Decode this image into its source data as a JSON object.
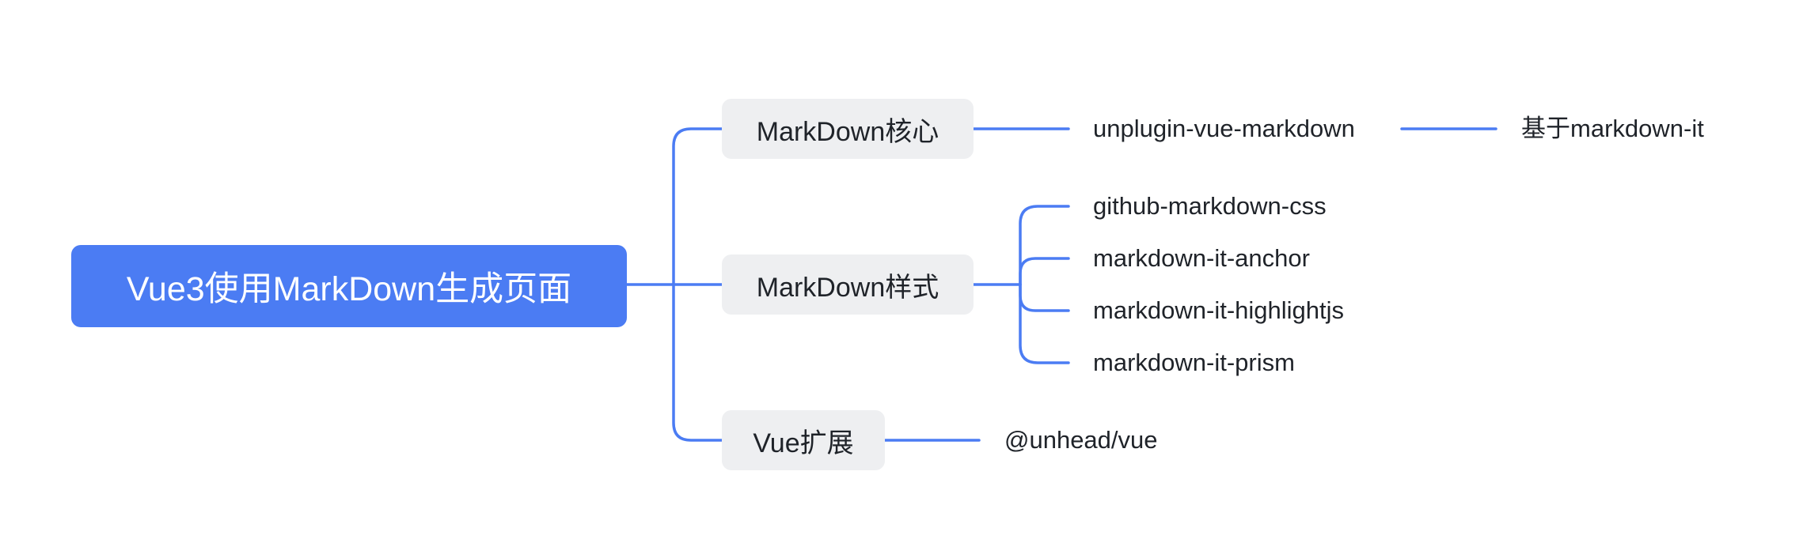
{
  "colors": {
    "root_fill": "#4b7cf3",
    "line": "#4b7cf3",
    "branch_fill": "#eeeff1",
    "text": "#1f2329"
  },
  "root": {
    "label": "Vue3使用MarkDown生成页面"
  },
  "branches": [
    {
      "label": "MarkDown核心",
      "children": [
        {
          "label": "unplugin-vue-markdown",
          "children": [
            {
              "label": "基于markdown-it"
            }
          ]
        }
      ]
    },
    {
      "label": "MarkDown样式",
      "children": [
        {
          "label": "github-markdown-css"
        },
        {
          "label": "markdown-it-anchor"
        },
        {
          "label": "markdown-it-highlightjs"
        },
        {
          "label": "markdown-it-prism"
        }
      ]
    },
    {
      "label": "Vue扩展",
      "children": [
        {
          "label": "@unhead/vue"
        }
      ]
    }
  ]
}
